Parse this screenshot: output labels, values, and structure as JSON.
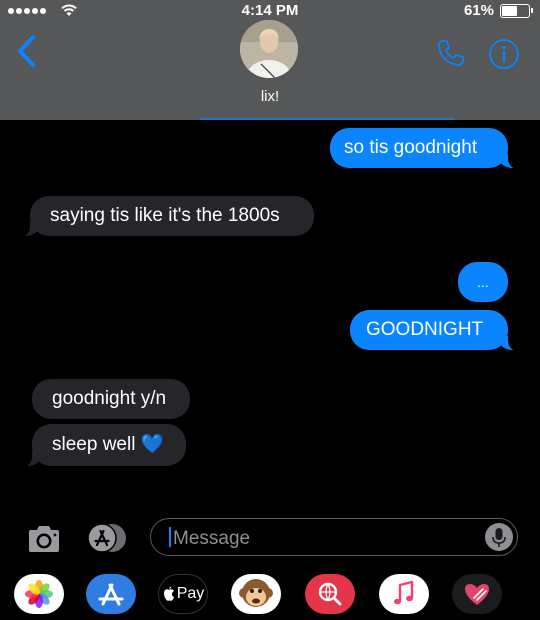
{
  "status_bar": {
    "time": "4:14 PM",
    "battery": "61%",
    "battery_level": 0.61
  },
  "header": {
    "contact_name": "lix!"
  },
  "messages": [
    {
      "side": "sent",
      "text": "so tis goodnight"
    },
    {
      "side": "received",
      "text": "saying tis like it's the 1800s"
    },
    {
      "side": "sent",
      "text": "..."
    },
    {
      "side": "sent",
      "text": "GOODNIGHT"
    },
    {
      "side": "received",
      "text": "goodnight y/n"
    },
    {
      "side": "received",
      "text": "sleep well 💙"
    }
  ],
  "composer": {
    "placeholder": "Message"
  },
  "app_drawer": {
    "apple_pay_label": "Pay"
  },
  "icons": [
    "camera-icon",
    "app-store-icon",
    "mic-icon",
    "photos-icon",
    "apple-pay-icon",
    "monkey-emoji-icon",
    "search-images-icon",
    "music-icon",
    "digital-touch-icon"
  ],
  "colors": {
    "sent_bubble": "#0a84ff",
    "received_bubble": "#26252a",
    "header": "#555758",
    "accent": "#0a84ff"
  }
}
